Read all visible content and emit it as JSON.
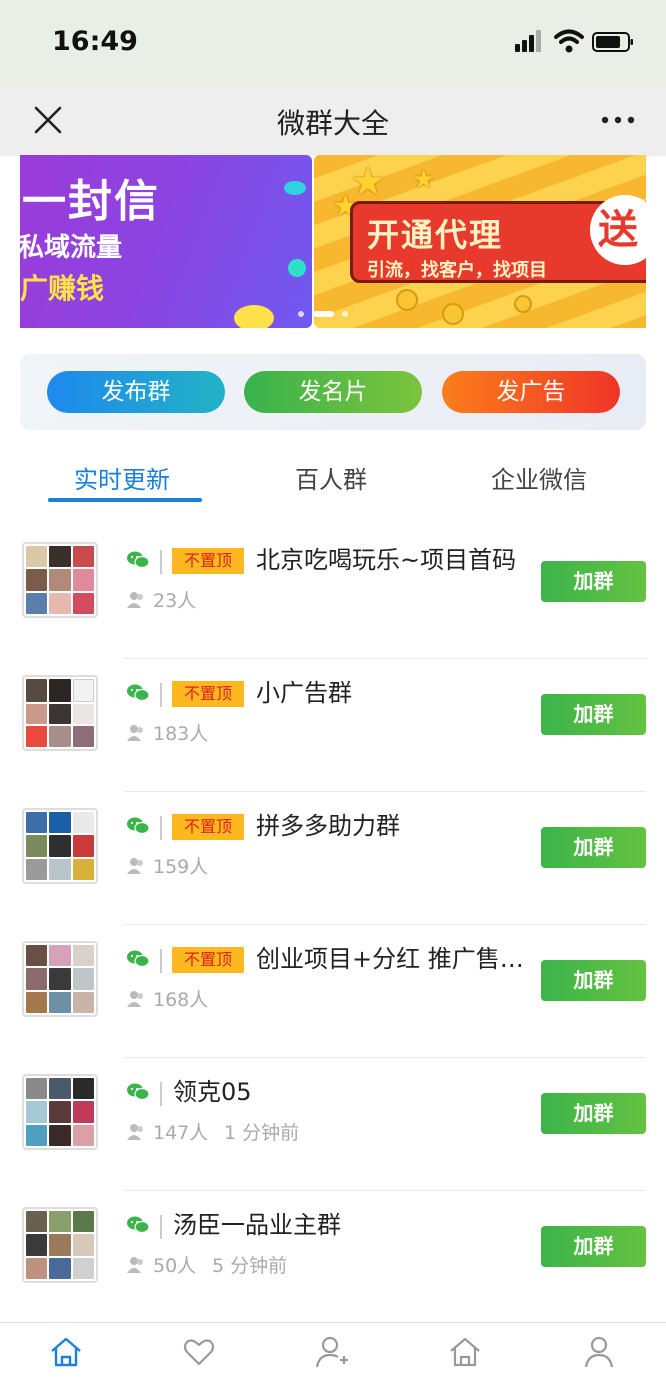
{
  "status": {
    "time": "16:49"
  },
  "header": {
    "title": "微群大全"
  },
  "banner": {
    "slide1": {
      "line1": "发一封信",
      "line2": "私域流量",
      "line3": "推广赚钱"
    },
    "slide2": {
      "title": "开通代理",
      "badge": "送",
      "subtitle": "引流，找客户，找项目"
    }
  },
  "actions": [
    {
      "label": "发布群",
      "color_from": "#1e88f0",
      "color_to": "#22b3c4"
    },
    {
      "label": "发名片",
      "color_from": "#38b24c",
      "color_to": "#7cc43c"
    },
    {
      "label": "发广告",
      "color_from": "#fb7e1a",
      "color_to": "#f03428"
    }
  ],
  "tabs": [
    {
      "label": "实时更新",
      "active": true
    },
    {
      "label": "百人群",
      "active": false
    },
    {
      "label": "企业微信",
      "active": false
    }
  ],
  "groups": [
    {
      "name": "北京吃喝玩乐~项目首码",
      "top_badge": "不置顶",
      "members": "23人",
      "time": "",
      "button": "加群"
    },
    {
      "name": "小广告群",
      "top_badge": "不置顶",
      "members": "183人",
      "time": "",
      "button": "加群"
    },
    {
      "name": "拼多多助力群",
      "top_badge": "不置顶",
      "members": "159人",
      "time": "",
      "button": "加群"
    },
    {
      "name": "创业项目+分红 推广售…",
      "top_badge": "不置顶",
      "members": "168人",
      "time": "",
      "button": "加群"
    },
    {
      "name": "领克05",
      "top_badge": "",
      "members": "147人",
      "time": "1 分钟前",
      "button": "加群"
    },
    {
      "name": "汤臣一品业主群",
      "top_badge": "",
      "members": "50人",
      "time": "5 分钟前",
      "button": "加群"
    }
  ],
  "bottom_nav": [
    {
      "icon": "home-icon",
      "active": true
    },
    {
      "icon": "heart-icon",
      "active": false
    },
    {
      "icon": "add-user-icon",
      "active": false
    },
    {
      "icon": "store-icon",
      "active": false
    },
    {
      "icon": "profile-icon",
      "active": false
    }
  ],
  "colors": {
    "accent": "#1a7fe0",
    "add_button": "#4cb844",
    "badge_bg": "#fcb81e",
    "badge_text": "#dd2222"
  }
}
